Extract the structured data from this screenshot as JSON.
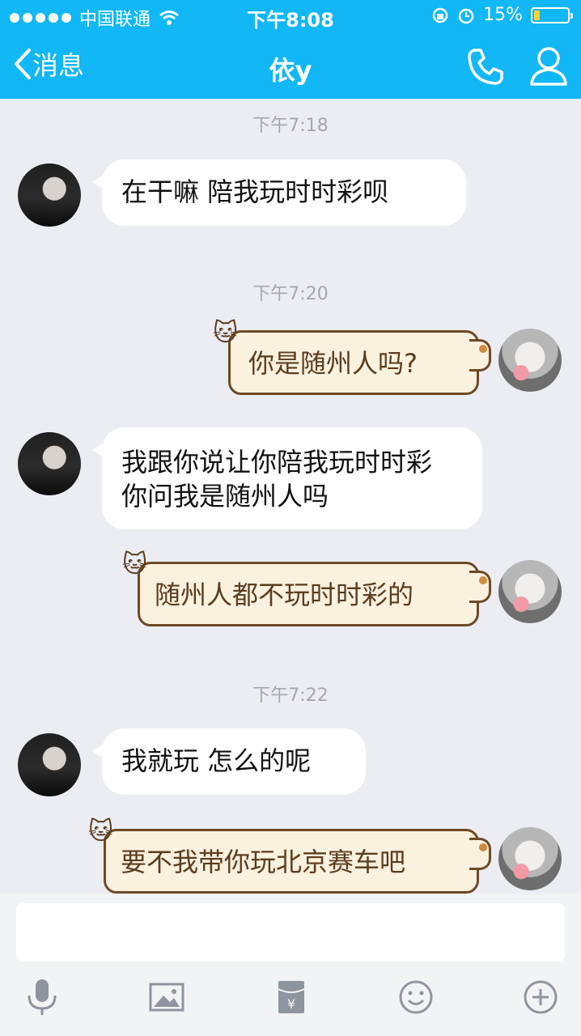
{
  "status_bar": {
    "carrier": "中国联通",
    "time": "下午8:08",
    "battery": "15%",
    "battery_level": 0.15
  },
  "nav": {
    "back_label": "消息",
    "title": "依y"
  },
  "messages": [
    {
      "type": "time",
      "text": "下午7:18"
    },
    {
      "type": "in",
      "text": "在干嘛  陪我玩时时彩呗"
    },
    {
      "type": "time",
      "text": "下午7:20"
    },
    {
      "type": "out",
      "text": "你是随州人吗?"
    },
    {
      "type": "in",
      "text": "我跟你说让你陪我玩时时彩  你问我是随州人吗"
    },
    {
      "type": "out",
      "text": "随州人都不玩时时彩的"
    },
    {
      "type": "time",
      "text": "下午7:22"
    },
    {
      "type": "in",
      "text": "我就玩 怎么的呢"
    },
    {
      "type": "out",
      "text": "要不我带你玩北京赛车吧"
    }
  ],
  "icons": [
    "signal-icon",
    "wifi-icon",
    "chevron-left-icon",
    "phone-icon",
    "profile-icon",
    "lock-rotate-icon",
    "alarm-icon",
    "battery-icon",
    "mic-icon",
    "image-icon",
    "red-packet-icon",
    "emoji-icon",
    "plus-icon"
  ],
  "colors": {
    "header": "#12b7f5",
    "background": "#ebedf2",
    "out_bubble_bg": "#fbf1df",
    "out_bubble_border": "#6e4a25"
  }
}
